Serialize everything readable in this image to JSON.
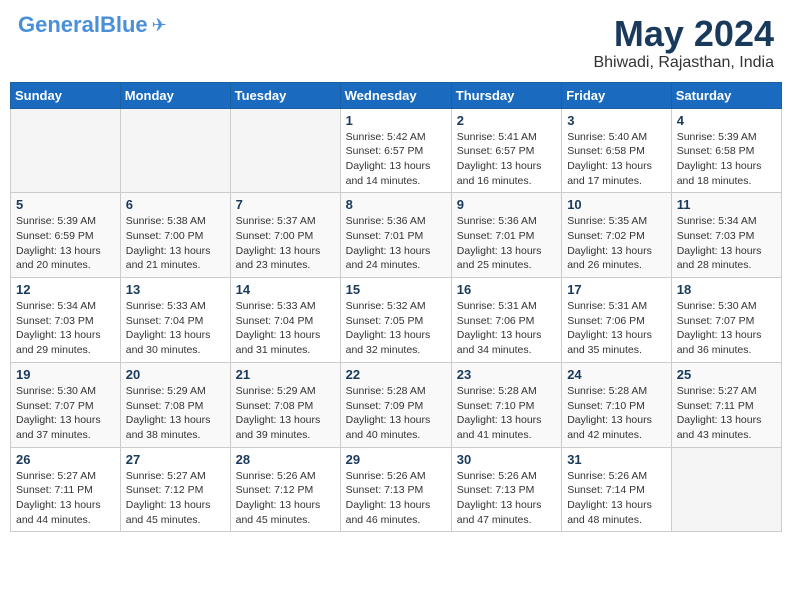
{
  "header": {
    "logo_general": "General",
    "logo_blue": "Blue",
    "month_year": "May 2024",
    "location": "Bhiwadi, Rajasthan, India"
  },
  "days_of_week": [
    "Sunday",
    "Monday",
    "Tuesday",
    "Wednesday",
    "Thursday",
    "Friday",
    "Saturday"
  ],
  "weeks": [
    [
      {
        "date": "",
        "sunrise": "",
        "sunset": "",
        "daylight": ""
      },
      {
        "date": "",
        "sunrise": "",
        "sunset": "",
        "daylight": ""
      },
      {
        "date": "",
        "sunrise": "",
        "sunset": "",
        "daylight": ""
      },
      {
        "date": "1",
        "sunrise": "Sunrise: 5:42 AM",
        "sunset": "Sunset: 6:57 PM",
        "daylight": "Daylight: 13 hours and 14 minutes."
      },
      {
        "date": "2",
        "sunrise": "Sunrise: 5:41 AM",
        "sunset": "Sunset: 6:57 PM",
        "daylight": "Daylight: 13 hours and 16 minutes."
      },
      {
        "date": "3",
        "sunrise": "Sunrise: 5:40 AM",
        "sunset": "Sunset: 6:58 PM",
        "daylight": "Daylight: 13 hours and 17 minutes."
      },
      {
        "date": "4",
        "sunrise": "Sunrise: 5:39 AM",
        "sunset": "Sunset: 6:58 PM",
        "daylight": "Daylight: 13 hours and 18 minutes."
      }
    ],
    [
      {
        "date": "5",
        "sunrise": "Sunrise: 5:39 AM",
        "sunset": "Sunset: 6:59 PM",
        "daylight": "Daylight: 13 hours and 20 minutes."
      },
      {
        "date": "6",
        "sunrise": "Sunrise: 5:38 AM",
        "sunset": "Sunset: 7:00 PM",
        "daylight": "Daylight: 13 hours and 21 minutes."
      },
      {
        "date": "7",
        "sunrise": "Sunrise: 5:37 AM",
        "sunset": "Sunset: 7:00 PM",
        "daylight": "Daylight: 13 hours and 23 minutes."
      },
      {
        "date": "8",
        "sunrise": "Sunrise: 5:36 AM",
        "sunset": "Sunset: 7:01 PM",
        "daylight": "Daylight: 13 hours and 24 minutes."
      },
      {
        "date": "9",
        "sunrise": "Sunrise: 5:36 AM",
        "sunset": "Sunset: 7:01 PM",
        "daylight": "Daylight: 13 hours and 25 minutes."
      },
      {
        "date": "10",
        "sunrise": "Sunrise: 5:35 AM",
        "sunset": "Sunset: 7:02 PM",
        "daylight": "Daylight: 13 hours and 26 minutes."
      },
      {
        "date": "11",
        "sunrise": "Sunrise: 5:34 AM",
        "sunset": "Sunset: 7:03 PM",
        "daylight": "Daylight: 13 hours and 28 minutes."
      }
    ],
    [
      {
        "date": "12",
        "sunrise": "Sunrise: 5:34 AM",
        "sunset": "Sunset: 7:03 PM",
        "daylight": "Daylight: 13 hours and 29 minutes."
      },
      {
        "date": "13",
        "sunrise": "Sunrise: 5:33 AM",
        "sunset": "Sunset: 7:04 PM",
        "daylight": "Daylight: 13 hours and 30 minutes."
      },
      {
        "date": "14",
        "sunrise": "Sunrise: 5:33 AM",
        "sunset": "Sunset: 7:04 PM",
        "daylight": "Daylight: 13 hours and 31 minutes."
      },
      {
        "date": "15",
        "sunrise": "Sunrise: 5:32 AM",
        "sunset": "Sunset: 7:05 PM",
        "daylight": "Daylight: 13 hours and 32 minutes."
      },
      {
        "date": "16",
        "sunrise": "Sunrise: 5:31 AM",
        "sunset": "Sunset: 7:06 PM",
        "daylight": "Daylight: 13 hours and 34 minutes."
      },
      {
        "date": "17",
        "sunrise": "Sunrise: 5:31 AM",
        "sunset": "Sunset: 7:06 PM",
        "daylight": "Daylight: 13 hours and 35 minutes."
      },
      {
        "date": "18",
        "sunrise": "Sunrise: 5:30 AM",
        "sunset": "Sunset: 7:07 PM",
        "daylight": "Daylight: 13 hours and 36 minutes."
      }
    ],
    [
      {
        "date": "19",
        "sunrise": "Sunrise: 5:30 AM",
        "sunset": "Sunset: 7:07 PM",
        "daylight": "Daylight: 13 hours and 37 minutes."
      },
      {
        "date": "20",
        "sunrise": "Sunrise: 5:29 AM",
        "sunset": "Sunset: 7:08 PM",
        "daylight": "Daylight: 13 hours and 38 minutes."
      },
      {
        "date": "21",
        "sunrise": "Sunrise: 5:29 AM",
        "sunset": "Sunset: 7:08 PM",
        "daylight": "Daylight: 13 hours and 39 minutes."
      },
      {
        "date": "22",
        "sunrise": "Sunrise: 5:28 AM",
        "sunset": "Sunset: 7:09 PM",
        "daylight": "Daylight: 13 hours and 40 minutes."
      },
      {
        "date": "23",
        "sunrise": "Sunrise: 5:28 AM",
        "sunset": "Sunset: 7:10 PM",
        "daylight": "Daylight: 13 hours and 41 minutes."
      },
      {
        "date": "24",
        "sunrise": "Sunrise: 5:28 AM",
        "sunset": "Sunset: 7:10 PM",
        "daylight": "Daylight: 13 hours and 42 minutes."
      },
      {
        "date": "25",
        "sunrise": "Sunrise: 5:27 AM",
        "sunset": "Sunset: 7:11 PM",
        "daylight": "Daylight: 13 hours and 43 minutes."
      }
    ],
    [
      {
        "date": "26",
        "sunrise": "Sunrise: 5:27 AM",
        "sunset": "Sunset: 7:11 PM",
        "daylight": "Daylight: 13 hours and 44 minutes."
      },
      {
        "date": "27",
        "sunrise": "Sunrise: 5:27 AM",
        "sunset": "Sunset: 7:12 PM",
        "daylight": "Daylight: 13 hours and 45 minutes."
      },
      {
        "date": "28",
        "sunrise": "Sunrise: 5:26 AM",
        "sunset": "Sunset: 7:12 PM",
        "daylight": "Daylight: 13 hours and 45 minutes."
      },
      {
        "date": "29",
        "sunrise": "Sunrise: 5:26 AM",
        "sunset": "Sunset: 7:13 PM",
        "daylight": "Daylight: 13 hours and 46 minutes."
      },
      {
        "date": "30",
        "sunrise": "Sunrise: 5:26 AM",
        "sunset": "Sunset: 7:13 PM",
        "daylight": "Daylight: 13 hours and 47 minutes."
      },
      {
        "date": "31",
        "sunrise": "Sunrise: 5:26 AM",
        "sunset": "Sunset: 7:14 PM",
        "daylight": "Daylight: 13 hours and 48 minutes."
      },
      {
        "date": "",
        "sunrise": "",
        "sunset": "",
        "daylight": ""
      }
    ]
  ]
}
